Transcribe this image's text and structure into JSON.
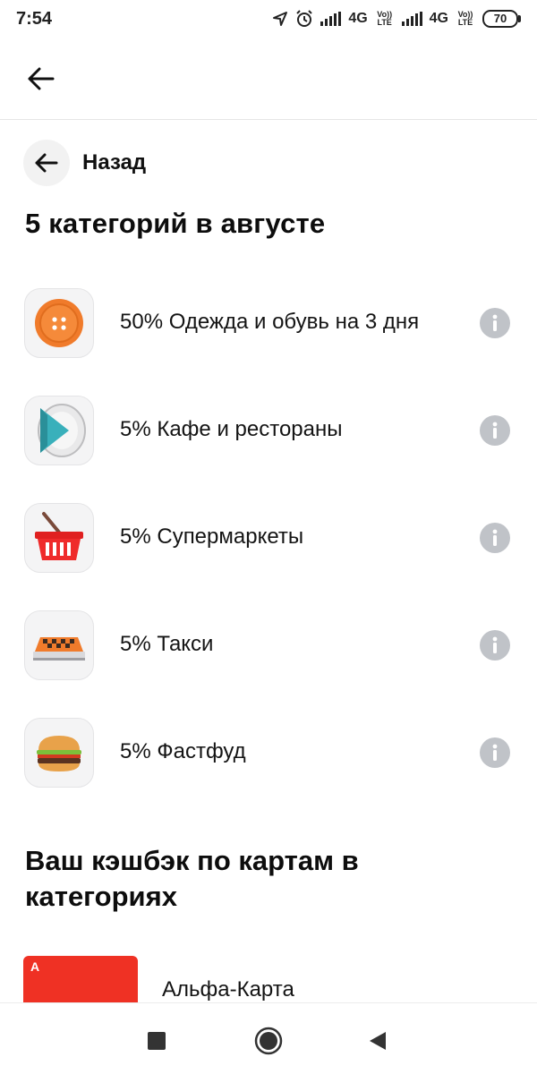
{
  "status_bar": {
    "time": "7:54",
    "network_1": "4G",
    "network_2": "4G",
    "volte": "Vo)) LTE",
    "battery": "70",
    "icons": [
      "location-icon",
      "alarm-icon",
      "signal-icon",
      "signal-icon"
    ]
  },
  "header": {
    "back_icon": "arrow-left-icon"
  },
  "back_chip": {
    "label": "Назад",
    "icon": "arrow-left-icon"
  },
  "section_title": "5 категорий в августе",
  "categories": [
    {
      "label": "50% Одежда и обувь на 3 дня",
      "icon": "button-icon"
    },
    {
      "label": "5% Кафе и рестораны",
      "icon": "plate-icon"
    },
    {
      "label": "5% Супермаркеты",
      "icon": "basket-icon"
    },
    {
      "label": "5% Такси",
      "icon": "taxi-icon"
    },
    {
      "label": "5% Фастфуд",
      "icon": "burger-icon"
    }
  ],
  "cards_title": "Ваш кэшбэк по картам в категориях",
  "cards": [
    {
      "name": "Альфа-Карта",
      "logo": "А"
    }
  ],
  "colors": {
    "alfa_red": "#ef3124",
    "info_gray": "#c0c3c8",
    "icon_bg": "#f4f4f5"
  },
  "nav_bar": {
    "buttons": [
      "recents-square-icon",
      "home-circle-icon",
      "back-triangle-icon"
    ]
  }
}
